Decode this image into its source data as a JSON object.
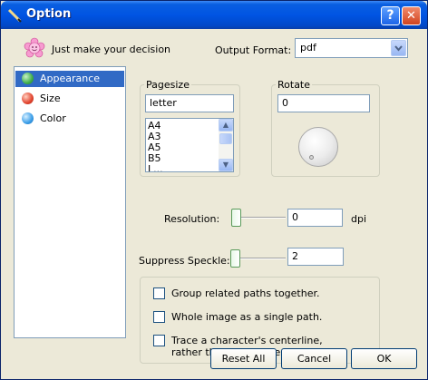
{
  "window": {
    "title": "Option"
  },
  "header": {
    "decision_text": "Just make your decision",
    "output_format_label": "Output Format:",
    "output_format_value": "pdf"
  },
  "nav": {
    "items": [
      {
        "label": "Appearance",
        "color": "#3fae49"
      },
      {
        "label": "Size",
        "color": "#e2442f"
      },
      {
        "label": "Color",
        "color": "#3a9de8"
      }
    ]
  },
  "pagesize": {
    "legend": "Pagesize",
    "value": "letter",
    "options": [
      "A4",
      "A3",
      "A5",
      "B5",
      "L..."
    ]
  },
  "rotate": {
    "legend": "Rotate",
    "value": "0"
  },
  "resolution": {
    "label": "Resolution:",
    "value": "0",
    "unit": "dpi",
    "level": 0
  },
  "speckle": {
    "label": "Suppress Speckle:",
    "value": "2",
    "level": 0
  },
  "options": {
    "group_paths": "Group related paths together.",
    "whole_image": "Whole image as a single path.",
    "trace_line1": "Trace a character's centerline,",
    "trace_line2": "rather than its outline"
  },
  "buttons": {
    "reset": "Reset All",
    "cancel": "Cancel",
    "ok": "OK"
  },
  "icons": {
    "app": "pen-icon",
    "smiley": "pink-smiley-icon",
    "help": "help-icon",
    "close": "close-icon"
  }
}
